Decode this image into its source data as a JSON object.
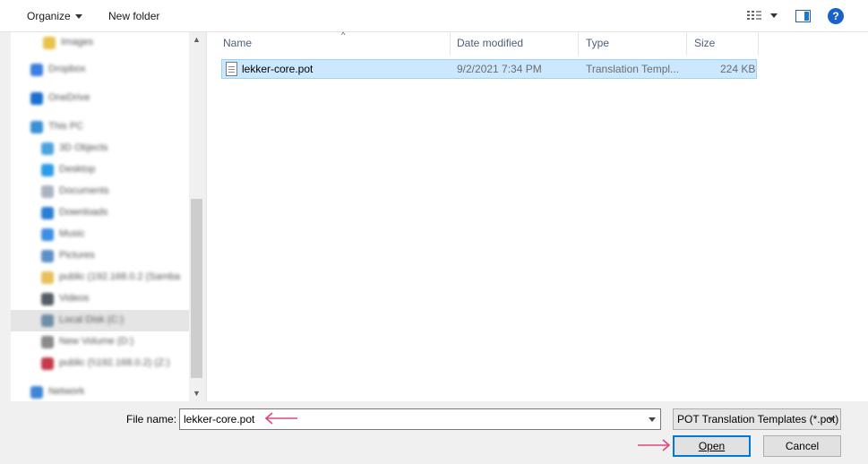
{
  "toolbar": {
    "organize_label": "Organize",
    "new_folder_label": "New folder",
    "help_label": "?"
  },
  "nav": {
    "items": [
      {
        "label": "Images",
        "icon": "folder-icon",
        "color": "#e8c34a",
        "indent": 36
      },
      {
        "label": "Dropbox",
        "icon": "dropbox-icon",
        "color": "#3b7fe0",
        "indent": 22
      },
      {
        "label": "OneDrive",
        "icon": "onedrive-icon",
        "color": "#1b6fcf",
        "indent": 22
      },
      {
        "label": "This PC",
        "icon": "computer-icon",
        "color": "#3a8fd6",
        "indent": 22
      },
      {
        "label": "3D Objects",
        "icon": "cube-icon",
        "color": "#4aa3df",
        "indent": 34
      },
      {
        "label": "Desktop",
        "icon": "desktop-icon",
        "color": "#2c9be8",
        "indent": 34
      },
      {
        "label": "Documents",
        "icon": "documents-icon",
        "color": "#aab4c0",
        "indent": 34
      },
      {
        "label": "Downloads",
        "icon": "downloads-icon",
        "color": "#2a7fd4",
        "indent": 34
      },
      {
        "label": "Music",
        "icon": "music-icon",
        "color": "#3d8ee6",
        "indent": 34
      },
      {
        "label": "Pictures",
        "icon": "pictures-icon",
        "color": "#5c8fc8",
        "indent": 34
      },
      {
        "label": "public (192.168.0.2 (Samba",
        "icon": "network-drive-icon",
        "color": "#e6c05a",
        "indent": 34
      },
      {
        "label": "Videos",
        "icon": "videos-icon",
        "color": "#555c66",
        "indent": 34
      },
      {
        "label": "Local Disk (C:)",
        "icon": "disk-icon",
        "color": "#6f8ea8",
        "indent": 34,
        "selected": true
      },
      {
        "label": "New Volume (D:)",
        "icon": "disk-icon",
        "color": "#8a8a8a",
        "indent": 34
      },
      {
        "label": "public (\\\\192.168.0.2) (Z:)",
        "icon": "network-drive-icon",
        "color": "#c43a4a",
        "indent": 34
      },
      {
        "label": "Network",
        "icon": "network-icon",
        "color": "#3f86d6",
        "indent": 22
      }
    ]
  },
  "list": {
    "columns": {
      "name": "Name",
      "date": "Date modified",
      "type": "Type",
      "size": "Size"
    },
    "files": [
      {
        "name": "lekker-core.pot",
        "date": "9/2/2021 7:34 PM",
        "type": "Translation Templ...",
        "size": "224 KB"
      }
    ]
  },
  "footer": {
    "file_name_label": "File name:",
    "file_name_value": "lekker-core.pot",
    "filter_value": "POT Translation Templates (*.pot)",
    "open_label": "Open",
    "cancel_label": "Cancel"
  },
  "colors": {
    "selection_bg": "#cce8ff",
    "selection_border": "#99d1ff",
    "annotation": "#e0457b",
    "default_button_border": "#0078d7"
  }
}
